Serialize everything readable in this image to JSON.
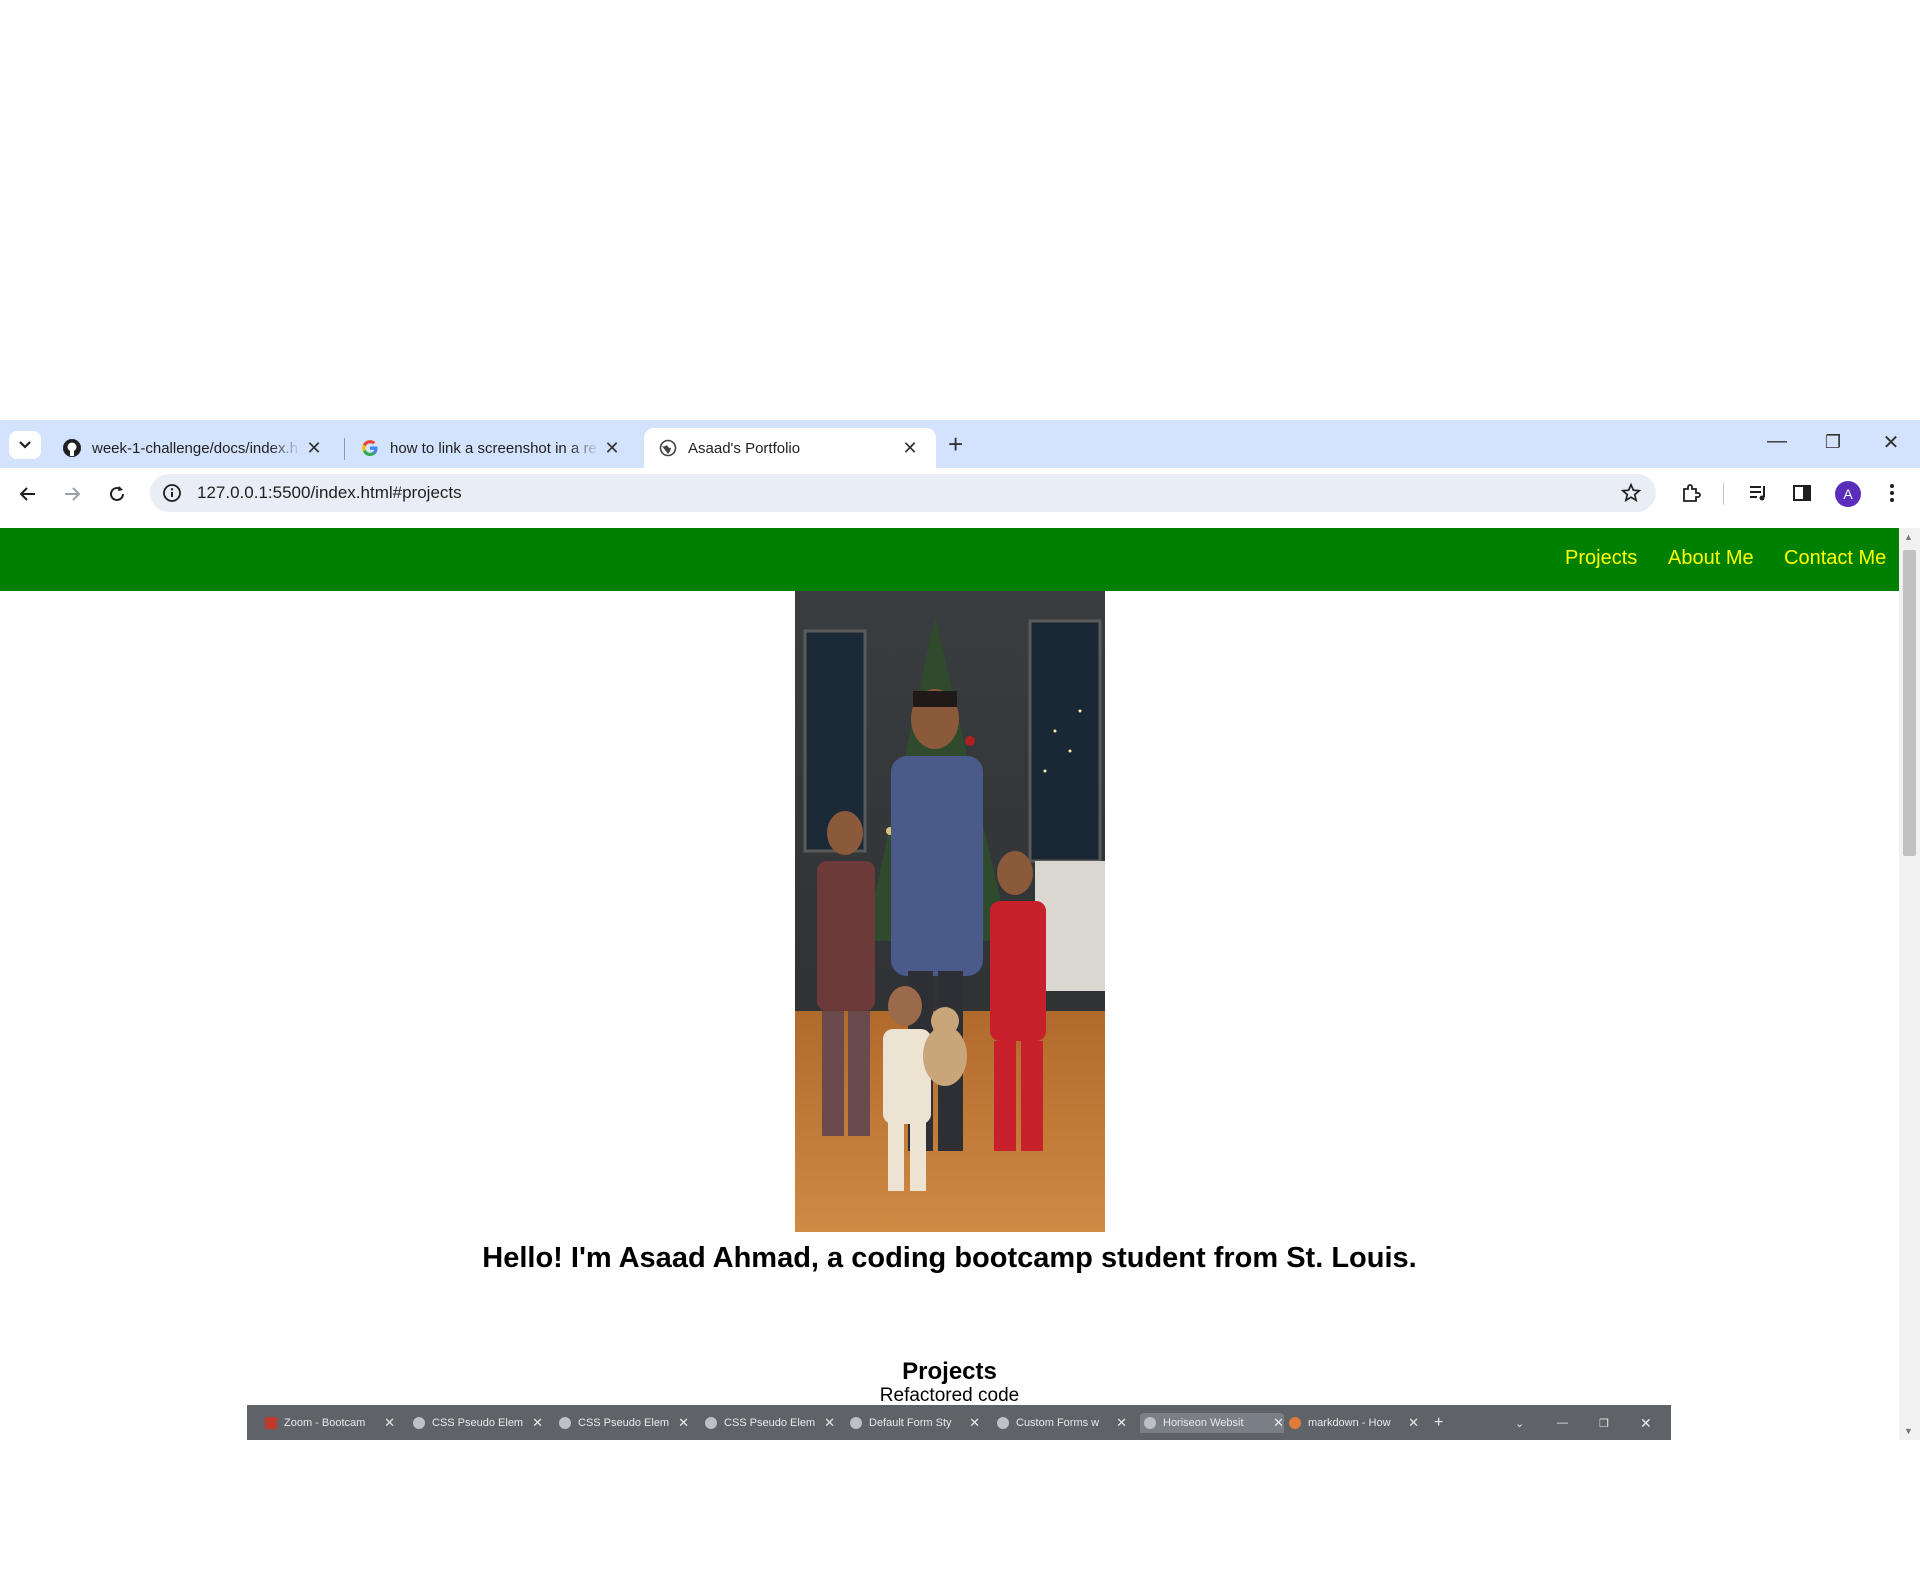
{
  "browser": {
    "tabs": [
      {
        "title": "week-1-challenge/docs/index.h",
        "icon": "github-icon"
      },
      {
        "title": "how to link a screenshot in a re",
        "icon": "google-icon"
      },
      {
        "title": "Asaad's Portfolio",
        "icon": "globe-icon",
        "active": true
      }
    ],
    "new_tab_label": "+",
    "url": "127.0.0.1:5500/index.html#projects",
    "profile_initial": "A"
  },
  "site": {
    "nav": {
      "projects": "Projects",
      "about": "About Me",
      "contact": "Contact Me"
    },
    "hero_heading": "Hello! I'm Asaad Ahmad, a coding bootcamp student from St. Louis.",
    "projects_heading": "Projects",
    "project_1": "Refactored code",
    "embedded_tabs": [
      {
        "title": "Zoom - Bootcam"
      },
      {
        "title": "CSS Pseudo Elem"
      },
      {
        "title": "CSS Pseudo Elem"
      },
      {
        "title": "CSS Pseudo Elem"
      },
      {
        "title": "Default Form Sty"
      },
      {
        "title": "Custom Forms w"
      },
      {
        "title": "Horiseon Websit",
        "active": true
      },
      {
        "title": "markdown - How"
      }
    ]
  },
  "colors": {
    "nav_bg": "#008000",
    "nav_link": "#ffff00",
    "tabstrip": "#d3e3fd"
  }
}
